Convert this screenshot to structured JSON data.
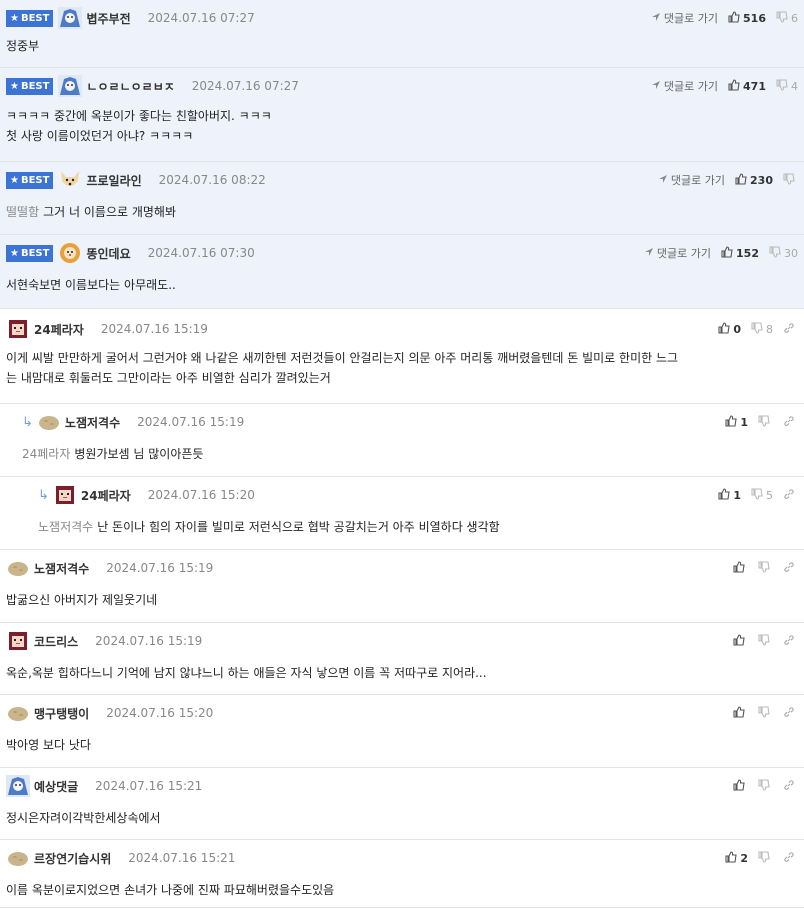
{
  "labels": {
    "best": "BEST",
    "reply_link": "댓글로 가기"
  },
  "colors": {
    "best_bg": "#eef2fb",
    "best_badge": "#3b74d4"
  },
  "comments": [
    {
      "best": true,
      "avatar": "blue-hair-avatar",
      "nick": "볍주부전",
      "date": "2024.07.16 07:27",
      "likes": "516",
      "dislikes": "6",
      "lines": [
        "정중부"
      ]
    },
    {
      "best": true,
      "avatar": "blue-hair-avatar",
      "nick": "ㄴㅇㄹㄴㅇㄹㅂㅈ",
      "date": "2024.07.16 07:27",
      "likes": "471",
      "dislikes": "4",
      "lines": [
        "ㅋㅋㅋㅋ 중간에 옥분이가 좋다는 친할아버지. ㅋㅋㅋ",
        "첫 사랑 이름이었던거 아냐? ㅋㅋㅋㅋ"
      ]
    },
    {
      "best": true,
      "avatar": "dog-avatar",
      "nick": "프로일라인",
      "date": "2024.07.16 08:22",
      "likes": "230",
      "dislikes": "",
      "mention": "떨떨함",
      "lines": [
        "그거 너 이름으로 개명해봐"
      ]
    },
    {
      "best": true,
      "avatar": "lion-avatar",
      "nick": "똥인데요",
      "date": "2024.07.16 07:30",
      "likes": "152",
      "dislikes": "30",
      "lines": [
        "서현숙보면 이름보다는 아무래도.."
      ]
    },
    {
      "best": false,
      "avatar": "pixel-avatar",
      "nick": "24페라자",
      "date": "2024.07.16 15:19",
      "likes": "0",
      "dislikes": "8",
      "lines": [
        "이게 씨발 만만하게 굴어서 그런거야 왜 나같은 새끼한텐 저런것들이 안걸리는지 의문 아주 머리통 깨버렸을텐데 돈 빌미로 한미한 느그",
        "는 내맘대로 휘둘러도 그만이라는 아주 비열한 심리가 깔려있는거"
      ]
    },
    {
      "best": false,
      "reply": true,
      "avatar": "potato-avatar",
      "nick": "노잼저격수",
      "date": "2024.07.16 15:19",
      "likes": "1",
      "dislikes": "",
      "mention": "24페라자",
      "lines": [
        "병원가보셈 님 많이아픈듯"
      ]
    },
    {
      "best": false,
      "reply": true,
      "avatar": "pixel-avatar",
      "nick": "24페라자",
      "date": "2024.07.16 15:20",
      "likes": "1",
      "dislikes": "5",
      "mention": "노잼저격수",
      "lines": [
        "난 돈이나 힘의 자이를 빌미로 저런식으로 협박 공갈치는거 아주 비열하다 생각함"
      ]
    },
    {
      "best": false,
      "avatar": "potato-avatar",
      "nick": "노잼저격수",
      "date": "2024.07.16 15:19",
      "likes": "",
      "dislikes": "",
      "lines": [
        "밥굶으신 아버지가 제일웃기네"
      ]
    },
    {
      "best": false,
      "avatar": "pixel-avatar",
      "nick": "코드리스",
      "date": "2024.07.16 15:19",
      "likes": "",
      "dislikes": "",
      "lines": [
        "옥순,옥분 힙하다느니 기억에 남지 않냐느니 하는 애들은 자식 낳으면 이름 꼭 저따구로 지어라..."
      ]
    },
    {
      "best": false,
      "avatar": "potato-avatar",
      "nick": "맹구탱탱이",
      "date": "2024.07.16 15:20",
      "likes": "",
      "dislikes": "",
      "lines": [
        "박아영 보다 낫다"
      ]
    },
    {
      "best": false,
      "avatar": "blue-hair-avatar",
      "nick": "예상댓글",
      "date": "2024.07.16 15:21",
      "likes": "",
      "dislikes": "",
      "lines": [
        "정시은자려이각박한세상속에서"
      ]
    },
    {
      "best": false,
      "avatar": "potato-avatar",
      "nick": "르장연기습시위",
      "date": "2024.07.16 15:21",
      "likes": "2",
      "dislikes": "",
      "lines": [
        "이름 옥분이로지었으면 손녀가 나중에 진짜 파묘해버렸을수도있음"
      ]
    }
  ]
}
